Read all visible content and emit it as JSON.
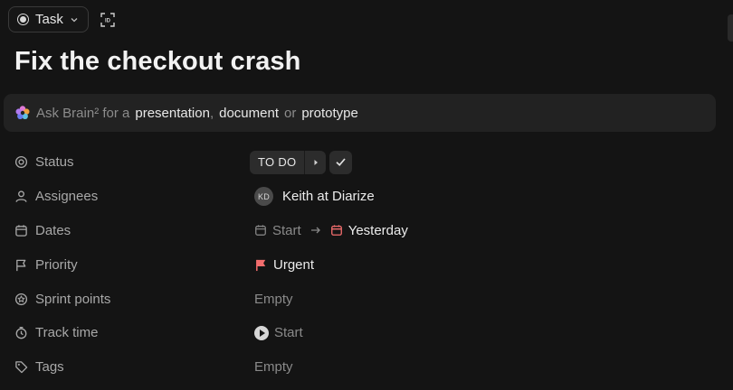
{
  "topbar": {
    "type_label": "Task",
    "id_label": "ID"
  },
  "task": {
    "title": "Fix the checkout crash"
  },
  "brain": {
    "prefix": "Ask Brain² for a",
    "opt1": "presentation",
    "sep1": ",",
    "opt2": "document",
    "sep2": "or",
    "opt3": "prototype"
  },
  "fields": {
    "status": {
      "label": "Status",
      "value": "TO DO"
    },
    "assignees": {
      "label": "Assignees",
      "initials": "KD",
      "name": "Keith at Diarize"
    },
    "dates": {
      "label": "Dates",
      "start": "Start",
      "end": "Yesterday"
    },
    "priority": {
      "label": "Priority",
      "value": "Urgent"
    },
    "sprint": {
      "label": "Sprint points",
      "value": "Empty"
    },
    "track": {
      "label": "Track time",
      "value": "Start"
    },
    "tags": {
      "label": "Tags",
      "value": "Empty"
    }
  },
  "colors": {
    "urgent": "#f26d6d",
    "end_date": "#f26d6d",
    "background": "#141414"
  }
}
